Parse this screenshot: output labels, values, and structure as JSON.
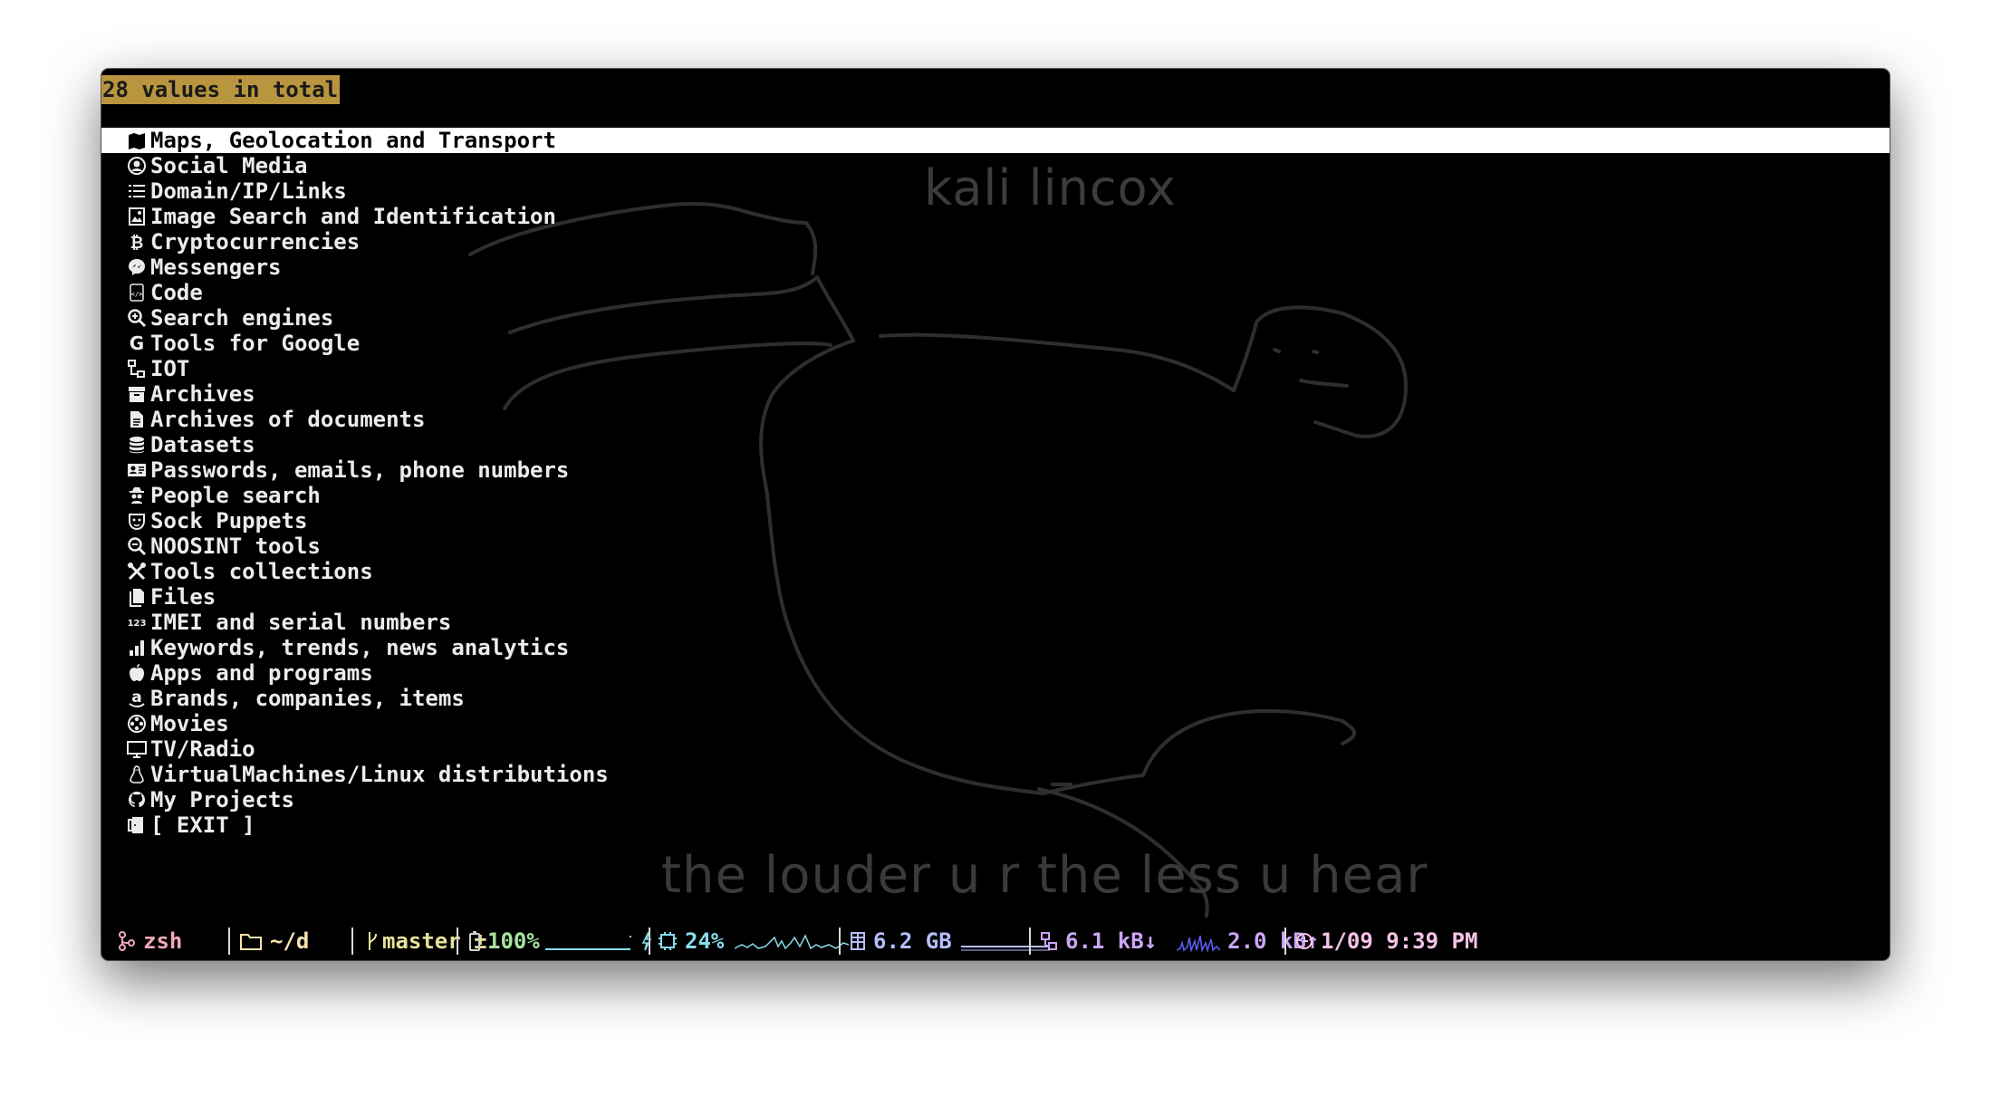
{
  "header": {
    "count_text": "28 values in total"
  },
  "menu": {
    "items": [
      {
        "label": "Maps, Geolocation and Transport",
        "icon": "map-icon",
        "selected": true
      },
      {
        "label": "Social Media",
        "icon": "user-circle-icon"
      },
      {
        "label": "Domain/IP/Links",
        "icon": "list-icon"
      },
      {
        "label": "Image Search and Identification",
        "icon": "image-icon"
      },
      {
        "label": "Cryptocurrencies",
        "icon": "bitcoin-icon"
      },
      {
        "label": "Messengers",
        "icon": "messenger-icon"
      },
      {
        "label": "Code",
        "icon": "code-file-icon"
      },
      {
        "label": "Search engines",
        "icon": "search-plus-icon"
      },
      {
        "label": "Tools for Google",
        "icon": "google-icon"
      },
      {
        "label": "IOT",
        "icon": "network-icon"
      },
      {
        "label": "Archives",
        "icon": "archive-box-icon"
      },
      {
        "label": "Archives of documents",
        "icon": "document-icon"
      },
      {
        "label": "Datasets",
        "icon": "database-icon"
      },
      {
        "label": "Passwords, emails, phone numbers",
        "icon": "id-card-icon"
      },
      {
        "label": "People search",
        "icon": "spy-icon"
      },
      {
        "label": "Sock Puppets",
        "icon": "mask-icon"
      },
      {
        "label": "NOOSINT tools",
        "icon": "search-minus-icon"
      },
      {
        "label": "Tools collections",
        "icon": "tools-icon"
      },
      {
        "label": "Files",
        "icon": "files-icon"
      },
      {
        "label": "IMEI and serial numbers",
        "icon": "numbers-123-icon"
      },
      {
        "label": "Keywords, trends, news analytics",
        "icon": "bar-chart-icon"
      },
      {
        "label": "Apps and programs",
        "icon": "apple-icon"
      },
      {
        "label": "Brands, companies, items",
        "icon": "amazon-icon"
      },
      {
        "label": "Movies",
        "icon": "film-reel-icon"
      },
      {
        "label": "TV/Radio",
        "icon": "monitor-icon"
      },
      {
        "label": "VirtualMachines/Linux distributions",
        "icon": "linux-penguin-icon"
      },
      {
        "label": "My Projects",
        "icon": "github-icon"
      },
      {
        "label": "[ EXIT ]",
        "icon": "door-exit-icon"
      }
    ]
  },
  "watermark": {
    "top_text": "kali lincox",
    "bottom_text": "the louder u r the less u hear"
  },
  "statusbar": {
    "shell": "zsh",
    "directory": "~/d",
    "git_branch": "master ±",
    "battery": "100%",
    "battery_level": 1.0,
    "cpu": "24%",
    "memory": "6.2 GB",
    "net_down": "6.1 kB↓",
    "net_up": "2.0 kB↑",
    "clock": "1/09 9:39 PM"
  },
  "colors": {
    "header_bg": "#b8953e",
    "shell": "#f4a7b9",
    "directory": "#f9e2af",
    "git": "#e6e29a",
    "battery": "#a6e3a1",
    "cpu": "#89dceb",
    "memory": "#b4befe",
    "network": "#cba6f7",
    "clock": "#f5c2e7"
  }
}
